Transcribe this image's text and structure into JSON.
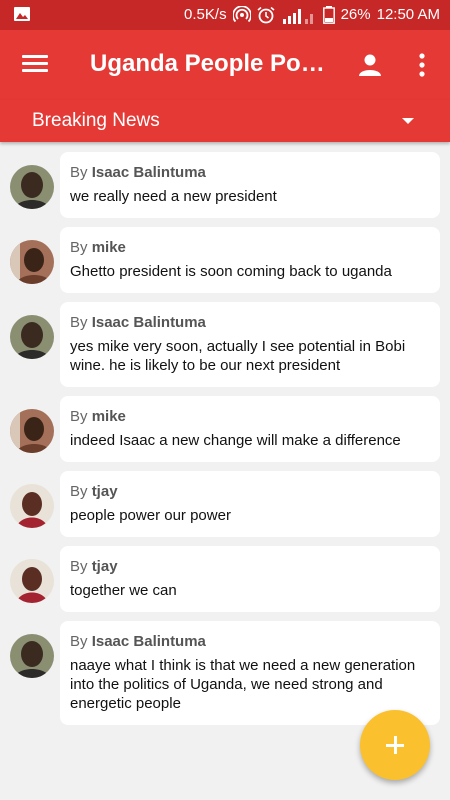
{
  "status_bar": {
    "speed": "0.5K/s",
    "battery": "26%",
    "time": "12:50 AM",
    "icons": [
      "image-icon",
      "hotspot-icon",
      "alarm-icon",
      "signal-icon",
      "battery-icon"
    ]
  },
  "app_bar": {
    "title": "Uganda People Po…",
    "icons": [
      "menu-icon",
      "account-icon",
      "more-vert-icon"
    ]
  },
  "channel": {
    "label": "Breaking News"
  },
  "messages": [
    {
      "by_prefix": "By",
      "author": "Isaac Balintuma",
      "text": "we really need a new president"
    },
    {
      "by_prefix": "By",
      "author": "mike",
      "text": "Ghetto president is soon coming back to uganda"
    },
    {
      "by_prefix": "By",
      "author": "Isaac Balintuma",
      "text": "yes mike very soon, actually I see potential in Bobi wine. he is likely to be our next president"
    },
    {
      "by_prefix": "By",
      "author": "mike",
      "text": "indeed Isaac a new change will make a difference"
    },
    {
      "by_prefix": "By",
      "author": "tjay",
      "text": "people power our power"
    },
    {
      "by_prefix": "By",
      "author": "tjay",
      "text": "together we can"
    },
    {
      "by_prefix": "By",
      "author": "Isaac Balintuma",
      "text": "naaye what I think is that we need a new generation into the politics of Uganda, we need strong and energetic people"
    }
  ],
  "colors": {
    "status_bar": "#c62828",
    "app_bar": "#e53935",
    "fab": "#fbc02d",
    "background": "#f1f1f1"
  }
}
